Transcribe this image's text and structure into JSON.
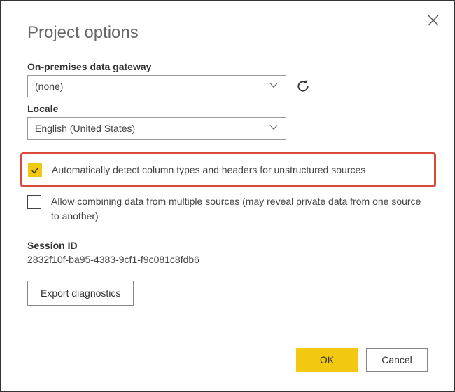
{
  "title": "Project options",
  "fields": {
    "gateway": {
      "label": "On-premises data gateway",
      "value": "(none)"
    },
    "locale": {
      "label": "Locale",
      "value": "English (United States)"
    }
  },
  "checkboxes": {
    "autodetect": {
      "label": "Automatically detect column types and headers for unstructured sources",
      "checked": true
    },
    "combine": {
      "label": "Allow combining data from multiple sources (may reveal private data from one source to another)",
      "checked": false
    }
  },
  "session": {
    "label": "Session ID",
    "value": "2832f10f-ba95-4383-9cf1-f9c081c8fdb6"
  },
  "buttons": {
    "export": "Export diagnostics",
    "ok": "OK",
    "cancel": "Cancel"
  }
}
